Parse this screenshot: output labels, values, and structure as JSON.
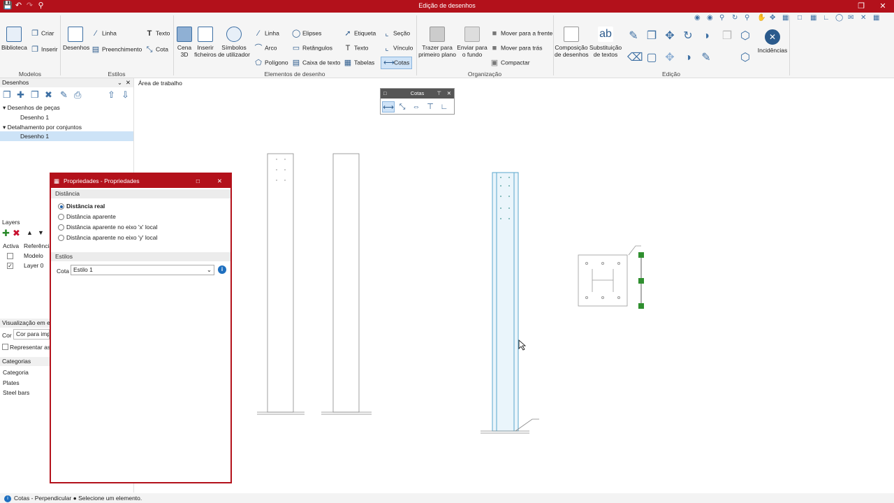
{
  "window": {
    "title": "Edição de desenhos"
  },
  "ribbon": {
    "modelos": {
      "biblioteca": "Biblioteca",
      "criar": "Criar",
      "inserir": "Inserir",
      "group": "Modelos"
    },
    "estilos": {
      "desenhos": "Desenhos",
      "linha": "Linha",
      "texto": "Texto",
      "preenchimento": "Preenchimento",
      "cota": "Cota",
      "group": "Estilos"
    },
    "elementos": {
      "cena3d": "Cena\n3D",
      "inserir_ficheiros": "Inserir\nficheiros",
      "simbolos": "Símbolos\nde utilizador",
      "linha": "Linha",
      "arco": "Arco",
      "poligono": "Polígono",
      "elipses": "Elipses",
      "retangulos": "Retângulos",
      "caixa_texto": "Caixa de texto",
      "etiqueta": "Etiqueta",
      "texto": "Texto",
      "tabelas": "Tabelas",
      "secao": "Seção",
      "vinculo": "Vínculo",
      "cotas": "Cotas",
      "group": "Elementos de desenho"
    },
    "organizacao": {
      "trazer": "Trazer para\nprimeiro plano",
      "enviar": "Enviar para\no fundo",
      "mover_frente": "Mover para a frente",
      "mover_tras": "Mover para trás",
      "compactar": "Compactar",
      "group": "Organização"
    },
    "edicao": {
      "composicao": "Composição\nde desenhos",
      "substituicao": "Substituição\nde textos",
      "group": "Edição"
    },
    "incidencias": "Incidências"
  },
  "left_panel": {
    "desenhos_header": "Desenhos",
    "tree": {
      "pecas": "Desenhos de peças",
      "pecas_child": "Desenho 1",
      "conjuntos": "Detalhamento por conjuntos",
      "conjuntos_child": "Desenho 1"
    },
    "layers_header": "Layers",
    "layers_cols": {
      "activa": "Activa",
      "referencia": "Referência"
    },
    "layers": [
      {
        "name": "Modelo",
        "active": false
      },
      {
        "name": "Layer 0",
        "active": true
      }
    ],
    "visualizacao": "Visualização em ec",
    "cor_label": "Cor",
    "cor_value": "Cor para impr",
    "representar": "Representar as lin",
    "categorias_header": "Categorias",
    "categorias": [
      "Categoria",
      "Plates",
      "Steel bars"
    ]
  },
  "workarea": {
    "label": "Área de trabalho"
  },
  "cotas_toolbar": {
    "title": "Cotas"
  },
  "properties": {
    "title": "Propriedades - Propriedades",
    "section_distancia": "Distância",
    "options": [
      "Distância real",
      "Distância aparente",
      "Distância aparente no eixo 'x' local",
      "Distância aparente no eixo 'y' local"
    ],
    "selected_index": 0,
    "section_estilos": "Estilos",
    "cota_label": "Cota",
    "cota_value": "Estilo 1"
  },
  "status": {
    "text": "Cotas - Perpendicular ● Selecione um elemento."
  },
  "colors": {
    "accent": "#b3111b",
    "blue": "#3d6fa3"
  }
}
